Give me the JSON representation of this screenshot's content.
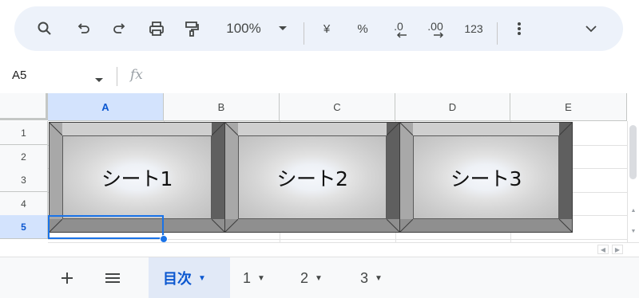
{
  "toolbar": {
    "zoom": "100%",
    "currency": "¥",
    "percent": "%",
    "decrease_decimal": ".0",
    "increase_decimal": ".00",
    "more_formats": "123"
  },
  "formula_bar": {
    "name_box": "A5",
    "fx_label": "fx"
  },
  "grid": {
    "columns": [
      "A",
      "B",
      "C",
      "D",
      "E"
    ],
    "rows": [
      "1",
      "2",
      "3",
      "4",
      "5"
    ],
    "selected_cell": "A5"
  },
  "buttons": [
    {
      "label": "シート1"
    },
    {
      "label": "シート2"
    },
    {
      "label": "シート3"
    }
  ],
  "sheet_tabs": [
    {
      "label": "目次",
      "active": true
    },
    {
      "label": "1",
      "active": false
    },
    {
      "label": "2",
      "active": false
    },
    {
      "label": "3",
      "active": false
    }
  ],
  "colors": {
    "accent": "#1a73e8",
    "active_tab_bg": "#e1e9f7",
    "toolbar_bg": "#edf2fa"
  }
}
